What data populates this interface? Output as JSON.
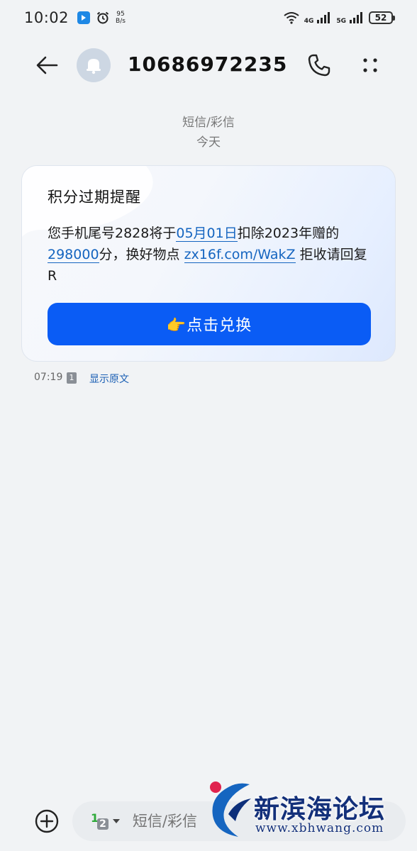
{
  "status_bar": {
    "time": "10:02",
    "net_speed_value": "95",
    "net_speed_unit": "B/s",
    "signal1_label": "4G",
    "signal2_label": "5G",
    "battery": "52"
  },
  "header": {
    "contact_number": "10686972235...",
    "icons": [
      "back-arrow-icon",
      "bell-icon",
      "phone-icon",
      "more-vertical-icon"
    ]
  },
  "thread": {
    "message_type": "短信/彩信",
    "date": "今天"
  },
  "message": {
    "title": "积分过期提醒",
    "body_part1": "您手机尾号2828将于",
    "date_link": "05月01日",
    "body_part2": "扣除2023年赠的",
    "points_link": "298000",
    "body_part3": "分，换好物点 ",
    "url_link": "zx16f.com/WakZ",
    "body_part4": " 拒收请回复R",
    "button_label": "👉点击兑换",
    "time": "07:19",
    "sim": "1",
    "show_original": "显示原文"
  },
  "compose": {
    "sim_primary": "1",
    "sim_secondary": "2",
    "placeholder": "短信/彩信"
  },
  "watermark": {
    "title": "新滨海论坛",
    "url": "www.xbhwang.com"
  },
  "colors": {
    "accent": "#0a5cf5",
    "link": "#1565c0",
    "background": "#f1f3f5"
  }
}
